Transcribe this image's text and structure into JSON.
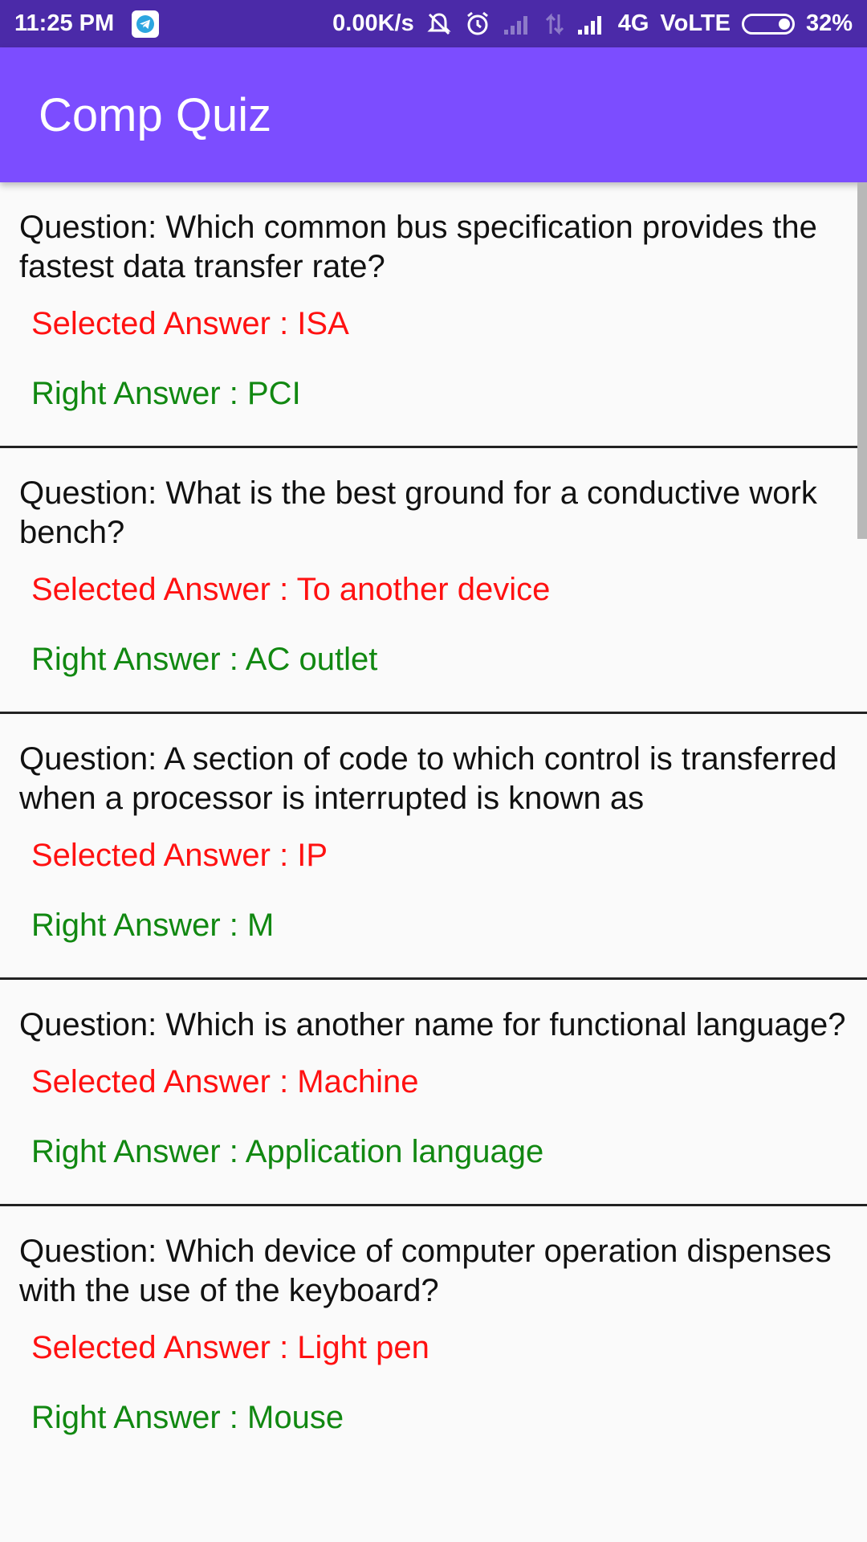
{
  "status_bar": {
    "time": "11:25 PM",
    "network_speed": "0.00K/s",
    "network_type": "4G",
    "volte": "VoLTE",
    "battery": "32%",
    "icons": [
      "telegram-icon",
      "mute-icon",
      "alarm-icon",
      "signal-icon",
      "data-arrows-icon",
      "signal-icon",
      "battery-icon"
    ]
  },
  "app_bar": {
    "title": "Comp Quiz"
  },
  "colors": {
    "status_bar": "#4b2aa8",
    "app_bar": "#7c4dff",
    "selected_answer": "#ff1111",
    "right_answer": "#118811"
  },
  "quiz_items": [
    {
      "question": "Question: Which common bus specification provides the fastest data transfer rate?",
      "selected": "Selected Answer : ISA",
      "right": "Right Answer : PCI"
    },
    {
      "question": "Question: What is the best ground for a conductive work bench?",
      "selected": "Selected Answer : To another device",
      "right": "Right Answer : AC outlet"
    },
    {
      "question": "Question: A section of code to which control is transferred when a processor is interrupted is known as",
      "selected": "Selected Answer : IP",
      "right": "Right Answer : M"
    },
    {
      "question": "Question: Which is another name for functional language?",
      "selected": "Selected Answer : Machine",
      "right": "Right Answer : Application language"
    },
    {
      "question": "Question: Which device of computer operation dispenses with the use of the keyboard?",
      "selected": "Selected Answer : Light pen",
      "right": "Right Answer : Mouse"
    }
  ]
}
